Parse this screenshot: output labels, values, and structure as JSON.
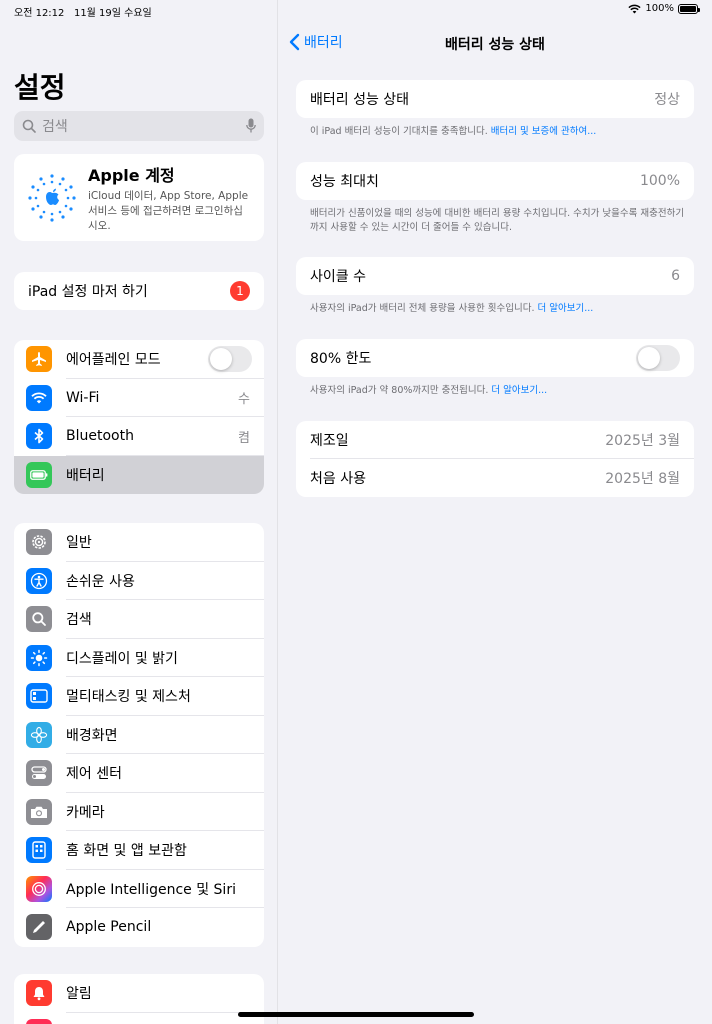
{
  "status": {
    "time": "오전 12:12",
    "date": "11월 19일 수요일",
    "battery": "100%"
  },
  "sidebar": {
    "title": "설정",
    "search_placeholder": "검색",
    "account": {
      "name": "Apple 계정",
      "desc": "iCloud 데이터, App Store, Apple 서비스 등에 접근하려면 로그인하십시오."
    },
    "setup": {
      "label": "iPad 설정 마저 하기",
      "badge": "1"
    },
    "group1": [
      {
        "label": "에어플레인 모드",
        "value": "",
        "color": "#ff9500",
        "icon": "airplane-icon"
      },
      {
        "label": "Wi-Fi",
        "value": "수",
        "color": "#007aff",
        "icon": "wifi-icon"
      },
      {
        "label": "Bluetooth",
        "value": "켬",
        "color": "#007aff",
        "icon": "bluetooth-icon"
      },
      {
        "label": "배터리",
        "value": "",
        "color": "#34c759",
        "icon": "battery-icon"
      }
    ],
    "group2": [
      {
        "label": "일반",
        "color": "#8e8e93",
        "icon": "gear-icon"
      },
      {
        "label": "손쉬운 사용",
        "color": "#007aff",
        "icon": "accessibility-icon"
      },
      {
        "label": "검색",
        "color": "#8e8e93",
        "icon": "search-icon"
      },
      {
        "label": "디스플레이 및 밝기",
        "color": "#007aff",
        "icon": "brightness-icon"
      },
      {
        "label": "멀티태스킹 및 제스처",
        "color": "#007aff",
        "icon": "multitasking-icon"
      },
      {
        "label": "배경화면",
        "color": "#32ade6",
        "icon": "wallpaper-icon"
      },
      {
        "label": "제어 센터",
        "color": "#8e8e93",
        "icon": "control-center-icon"
      },
      {
        "label": "카메라",
        "color": "#8e8e93",
        "icon": "camera-icon"
      },
      {
        "label": "홈 화면 및 앱 보관함",
        "color": "#007aff",
        "icon": "home-screen-icon"
      },
      {
        "label": "Apple Intelligence 및 Siri",
        "color": "#af52de",
        "icon": "siri-icon"
      },
      {
        "label": "Apple Pencil",
        "color": "#636366",
        "icon": "pencil-icon"
      }
    ],
    "group3": [
      {
        "label": "알림",
        "color": "#ff3b30",
        "icon": "notification-icon"
      }
    ]
  },
  "main": {
    "back_label": "배터리",
    "title": "배터리 성능 상태",
    "health": {
      "label": "배터리 성능 상태",
      "value": "정상",
      "footer": "이 iPad 배터리 성능이 기대치를 충족합니다.",
      "footer_link": "배터리 및 보증에 관하여..."
    },
    "capacity": {
      "label": "성능 최대치",
      "value": "100%",
      "footer": "배터리가 신품이었을 때의 성능에 대비한 배터리 용량 수치입니다. 수치가 낮을수록 재충전하기까지 사용할 수 있는 시간이 더 줄어들 수 있습니다."
    },
    "cycle": {
      "label": "사이클 수",
      "value": "6",
      "footer": "사용자의 iPad가 배터리 전체 용량을 사용한 횟수입니다.",
      "footer_link": "더 알아보기..."
    },
    "limit": {
      "label": "80% 한도",
      "footer": "사용자의 iPad가 약 80%까지만 충전됩니다.",
      "footer_link": "더 알아보기..."
    },
    "manufacture": {
      "label": "제조일",
      "value": "2025년 3월"
    },
    "first_use": {
      "label": "처음 사용",
      "value": "2025년 8월"
    }
  }
}
